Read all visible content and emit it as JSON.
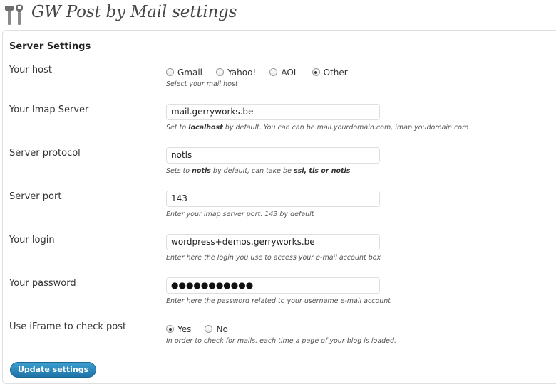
{
  "header": {
    "title": "GW Post by Mail settings",
    "icon": "tools-icon"
  },
  "section": {
    "title": "Server Settings"
  },
  "host": {
    "label": "Your host",
    "options": [
      "Gmail",
      "Yahoo!",
      "AOL",
      "Other"
    ],
    "selected": "Other",
    "description": "Select your mail host"
  },
  "imap_server": {
    "label": "Your Imap Server",
    "value": "mail.gerryworks.be",
    "desc_pre": "Set to ",
    "desc_bold": "localhost",
    "desc_post": " by default. You can can be mail.yourdomain.com, imap.youdomain.com"
  },
  "protocol": {
    "label": "Server protocol",
    "value": "notls",
    "desc_pre": "Sets to ",
    "desc_bold": "notls",
    "desc_mid": " by default, can take be ",
    "desc_bold2": "ssl, tls or notls"
  },
  "port": {
    "label": "Server port",
    "value": "143",
    "description": "Enter your imap server port. 143 by default"
  },
  "login": {
    "label": "Your login",
    "value": "wordpress+demos.gerryworks.be",
    "description": "Enter here the login you use to access your e-mail account box"
  },
  "password": {
    "label": "Your password",
    "masked_value": "●●●●●●●●●●●",
    "description": "Enter here the password related to your username e-mail account"
  },
  "iframe": {
    "label": "Use iFrame to check post",
    "options": [
      "Yes",
      "No"
    ],
    "selected": "Yes",
    "description": "In order to check for mails, each time a page of your blog is loaded."
  },
  "update_button": {
    "label": "Update settings"
  },
  "colors": {
    "button": "#2a85bc",
    "title": "#464646",
    "border": "#dfdfdf"
  }
}
